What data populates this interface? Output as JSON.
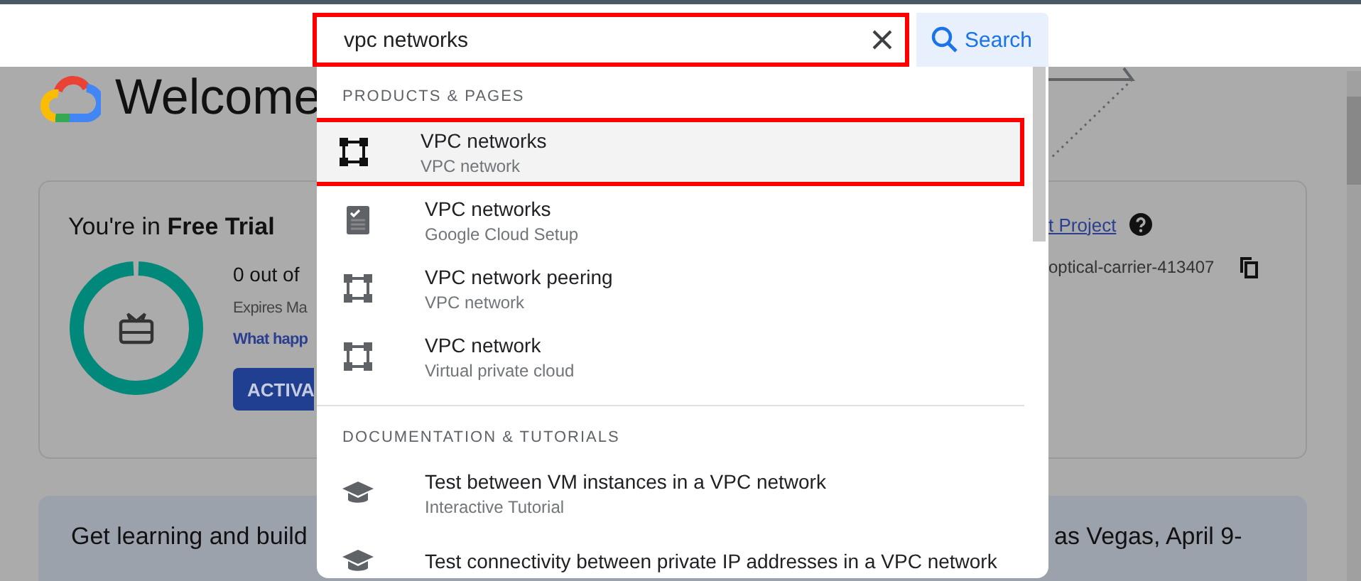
{
  "header": {
    "search": {
      "value": "vpc networks",
      "highlighted": true
    },
    "search_button": "Search"
  },
  "page": {
    "title": "Welcome",
    "trial_card": {
      "title": "You're in **Free Trial**",
      "credit": "0 out of",
      "expires": "Expires Ma",
      "link": "What happ",
      "button": "ACTIVA",
      "project_link": "t Project",
      "project_id": "optical-carrier-413407"
    },
    "banner": {
      "left": "Get learning and build",
      "right": "as Vegas, April 9-"
    }
  },
  "dropdown": {
    "sections": [
      {
        "heading": "PRODUCTS & PAGES",
        "items": [
          {
            "kind": "network",
            "title": "VPC networks",
            "subtitle": "VPC network",
            "selected": true,
            "highlighted": true
          },
          {
            "kind": "setup",
            "title": "VPC networks",
            "subtitle": "Google Cloud Setup",
            "selected": false,
            "highlighted": false
          },
          {
            "kind": "network",
            "title": "VPC network peering",
            "subtitle": "VPC network",
            "selected": false,
            "highlighted": false
          },
          {
            "kind": "network",
            "title": "VPC network",
            "subtitle": "Virtual private cloud",
            "selected": false,
            "highlighted": false
          }
        ]
      },
      {
        "heading": "DOCUMENTATION & TUTORIALS",
        "items": [
          {
            "kind": "tutorial",
            "title": "Test between VM instances in a VPC network",
            "subtitle": "Interactive Tutorial",
            "selected": false,
            "highlighted": false
          },
          {
            "kind": "tutorial",
            "title": "Test connectivity between private IP addresses in a VPC network",
            "selected": false,
            "highlighted": false
          }
        ]
      }
    ]
  }
}
